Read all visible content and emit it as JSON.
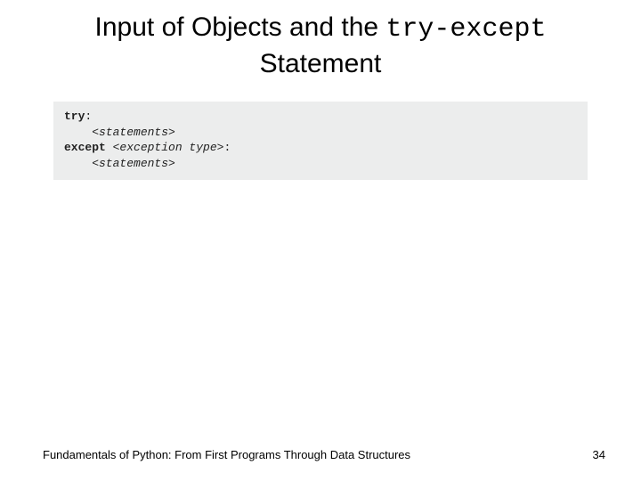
{
  "title": {
    "part1": "Input of Objects and the ",
    "code": "try-except",
    "part2": "Statement"
  },
  "code": {
    "l1a": "try",
    "l1b": ":",
    "l2": "    <statements>",
    "l3a": "except ",
    "l3b": "<exception type>",
    "l3c": ":",
    "l4": "    <statements>"
  },
  "footer": {
    "text": "Fundamentals of Python: From First Programs Through Data Structures",
    "page": "34"
  }
}
